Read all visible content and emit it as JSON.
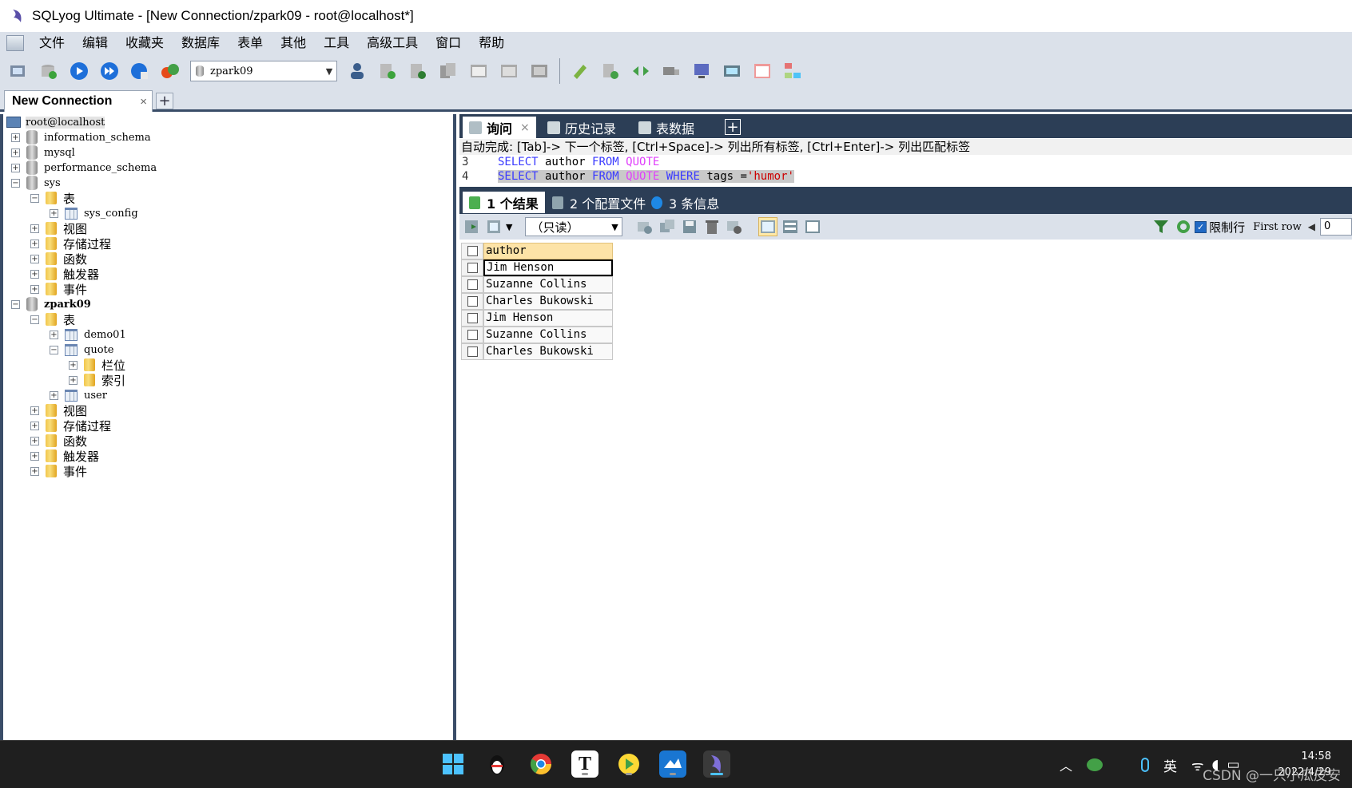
{
  "window": {
    "title": "SQLyog Ultimate - [New Connection/zpark09 - root@localhost*]"
  },
  "menu": [
    "文件",
    "编辑",
    "收藏夹",
    "数据库",
    "表单",
    "其他",
    "工具",
    "高级工具",
    "窗口",
    "帮助"
  ],
  "toolbar": {
    "db_select": "zpark09"
  },
  "connection_tab": {
    "label": "New Connection",
    "close": "×",
    "add": "+"
  },
  "tree": {
    "root": "root@localhost",
    "nodes": [
      {
        "label": "information_schema",
        "exp": "+"
      },
      {
        "label": "mysql",
        "exp": "+"
      },
      {
        "label": "performance_schema",
        "exp": "+"
      },
      {
        "label": "sys",
        "exp": "−"
      },
      {
        "label": "表",
        "exp": "−"
      },
      {
        "label": "sys_config",
        "exp": "+"
      },
      {
        "label": "视图",
        "exp": "+"
      },
      {
        "label": "存储过程",
        "exp": "+"
      },
      {
        "label": "函数",
        "exp": "+"
      },
      {
        "label": "触发器",
        "exp": "+"
      },
      {
        "label": "事件",
        "exp": "+"
      },
      {
        "label": "zpark09",
        "exp": "−"
      },
      {
        "label": "表",
        "exp": "−"
      },
      {
        "label": "demo01",
        "exp": "+"
      },
      {
        "label": "quote",
        "exp": "−"
      },
      {
        "label": "栏位",
        "exp": "+"
      },
      {
        "label": "索引",
        "exp": "+"
      },
      {
        "label": "user",
        "exp": "+"
      },
      {
        "label": "视图",
        "exp": "+"
      },
      {
        "label": "存储过程",
        "exp": "+"
      },
      {
        "label": "函数",
        "exp": "+"
      },
      {
        "label": "触发器",
        "exp": "+"
      },
      {
        "label": "事件",
        "exp": "+"
      }
    ]
  },
  "query_tabs": {
    "query": "询问",
    "history": "历史记录",
    "tabledata": "表数据",
    "close": "×",
    "add": "+"
  },
  "hint": "自动完成: [Tab]-> 下一个标签, [Ctrl+Space]-> 列出所有标签, [Ctrl+Enter]-> 列出匹配标签",
  "editor": {
    "lines": [
      {
        "no": "3",
        "kw1": "SELECT",
        "col": " author ",
        "kw2": "FROM",
        "tbl": " QUOTE"
      },
      {
        "no": "4",
        "kw1": "SELECT",
        "col": " author ",
        "kw2": "FROM",
        "tbl": " QUOTE ",
        "kw3": "WHERE",
        "rest": " tags =",
        "str": "'humor'"
      }
    ]
  },
  "result_tabs": {
    "results": "1 个结果",
    "profiles": "2 个配置文件",
    "messages": "3 条信息"
  },
  "result_toolbar": {
    "mode": "（只读）",
    "limit_label": "限制行",
    "first_row": "First row",
    "offset": "0"
  },
  "grid": {
    "header": "author",
    "rows": [
      "Jim Henson",
      "Suzanne Collins",
      "Charles Bukowski",
      "Jim Henson",
      "Suzanne Collins",
      "Charles Bukowski"
    ]
  },
  "taskbar": {
    "ime": "英",
    "time": "14:58",
    "date": "2022/4/29"
  },
  "watermark": "CSDN @一只小瓜皮安"
}
